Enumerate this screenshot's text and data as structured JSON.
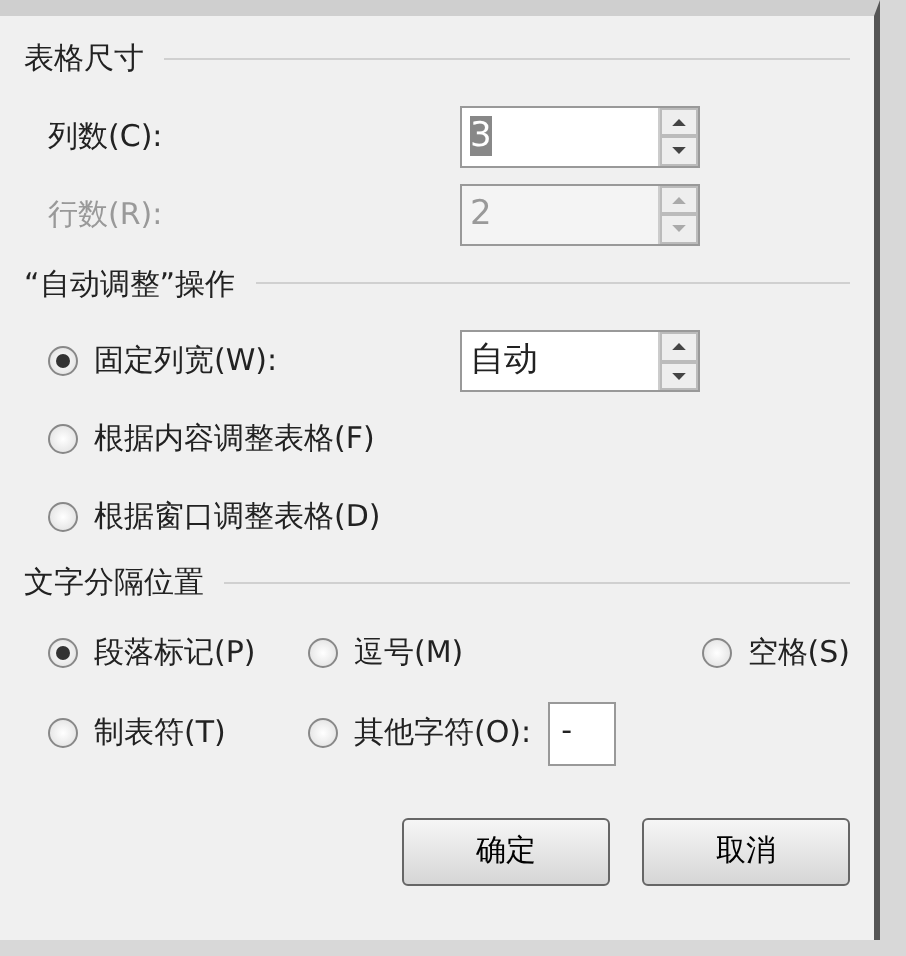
{
  "table_size": {
    "title": "表格尺寸",
    "fields": [
      {
        "label": "列数(C):",
        "value": "3",
        "highlighted": true,
        "disabled": false
      },
      {
        "label": "行数(R):",
        "value": "2",
        "highlighted": false,
        "disabled": true
      }
    ]
  },
  "autofit": {
    "title": "“自动调整”操作",
    "options": [
      {
        "label": "固定列宽(W):",
        "selected": true,
        "field_value": "自动"
      },
      {
        "label": "根据内容调整表格(F)",
        "selected": false
      },
      {
        "label": "根据窗口调整表格(D)",
        "selected": false
      }
    ]
  },
  "separator": {
    "title": "文字分隔位置",
    "options": [
      {
        "label": "段落标记(P)",
        "selected": true
      },
      {
        "label": "逗号(M)",
        "selected": false
      },
      {
        "label": "空格(S)",
        "selected": false
      },
      {
        "label": "制表符(T)",
        "selected": false
      },
      {
        "label": "其他字符(O):",
        "selected": false,
        "field_value": "-"
      }
    ]
  },
  "buttons": [
    {
      "label": "确定"
    },
    {
      "label": "取消"
    }
  ]
}
